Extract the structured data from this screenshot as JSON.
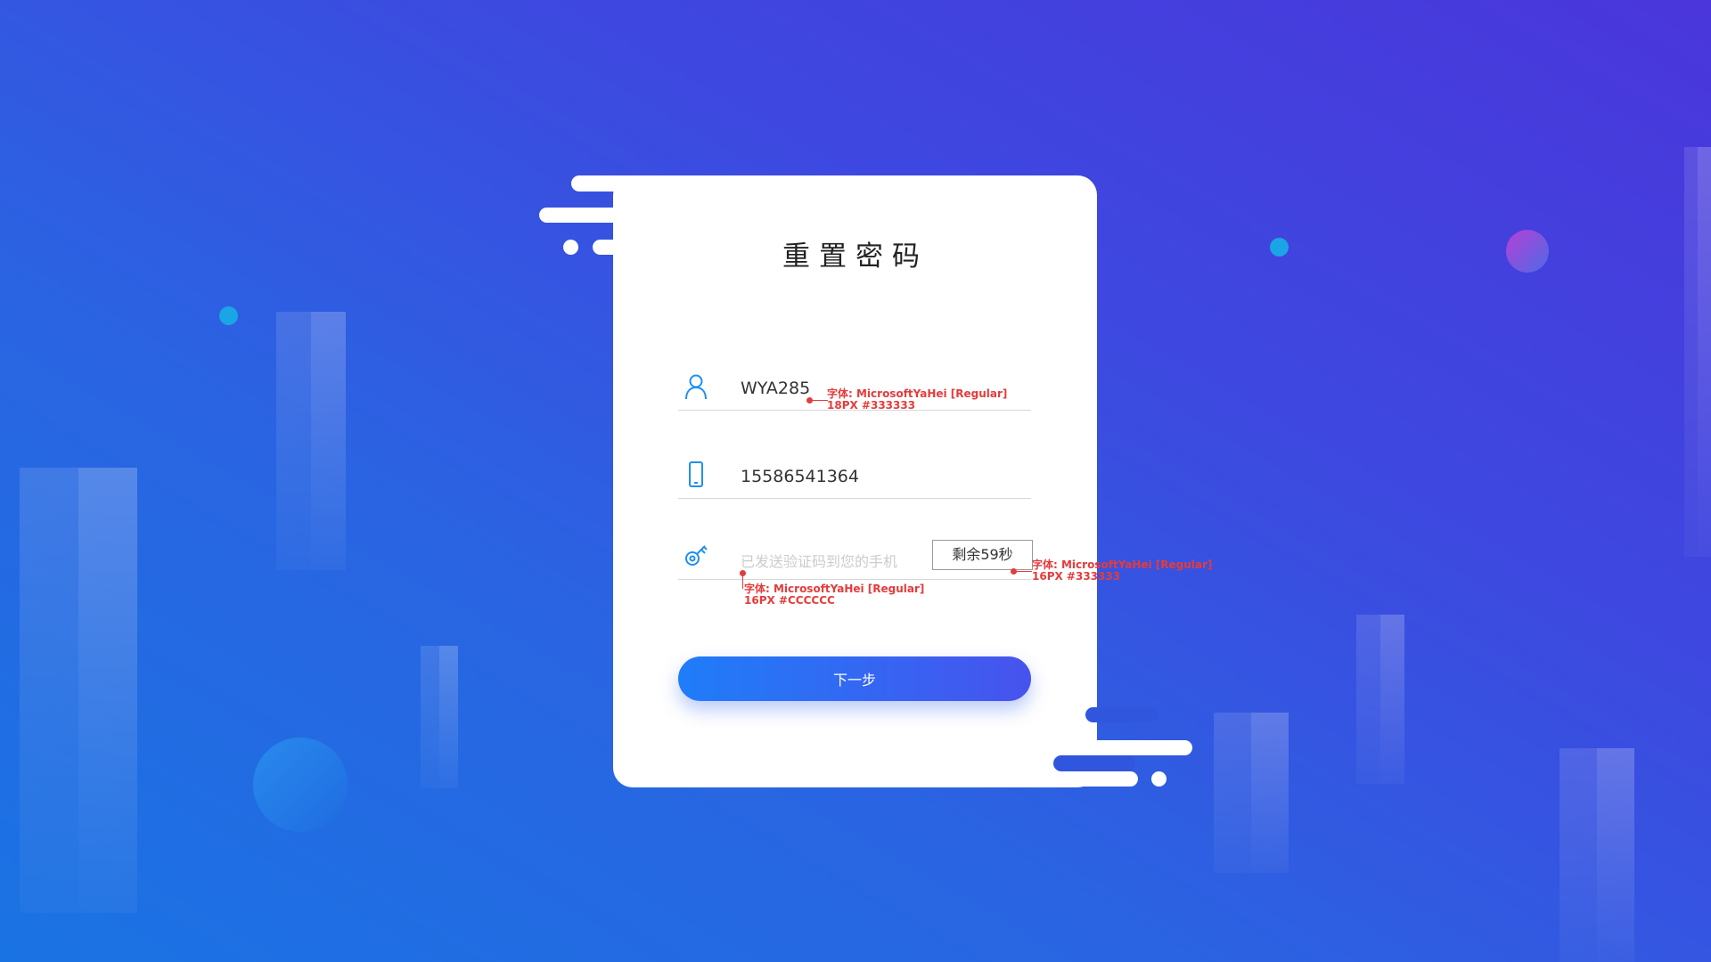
{
  "title": "重置密码",
  "fields": {
    "username": {
      "value": "WYA285",
      "icon": "user-icon"
    },
    "phone": {
      "value": "15586541364",
      "icon": "mobile-phone-icon"
    },
    "code": {
      "placeholder": "已发送验证码到您的手机",
      "icon": "key-icon",
      "countdown": "剩余59秒"
    }
  },
  "next_button": "下一步",
  "annotations": {
    "username": {
      "line1": "字体: MicrosoftYaHei [Regular]",
      "line2": "18PX #333333"
    },
    "code_input": {
      "line1": "字体: MicrosoftYaHei [Regular]",
      "line2": "16PX #CCCCCC"
    },
    "countdown": {
      "line1": "字体: MicrosoftYaHei [Regular]",
      "line2": "16PX #333333"
    }
  },
  "colors": {
    "button_start": "#1f7df8",
    "button_end": "#4753ee",
    "annotation": "#e63b3b",
    "icon": "#1f8ff0"
  }
}
